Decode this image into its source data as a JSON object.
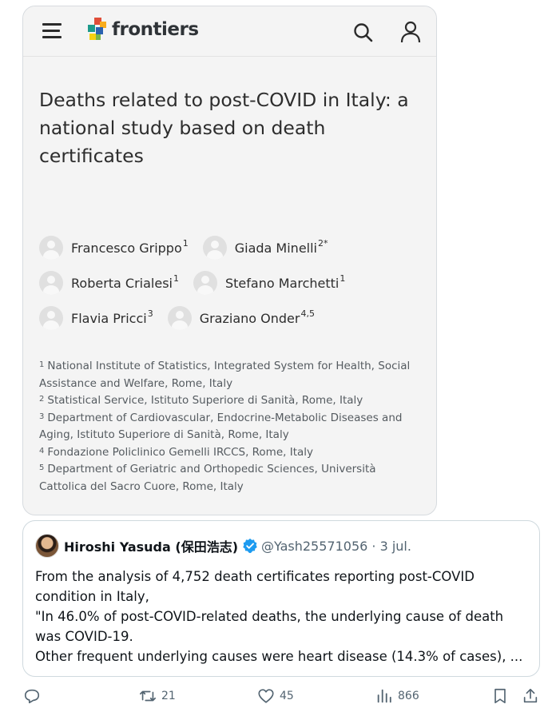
{
  "frontiers_card": {
    "brand": "frontiers",
    "title_lines": [
      "Deaths related to post-COVID in Italy: a",
      "national study based on death",
      "certificates"
    ],
    "authors": [
      {
        "name": "Francesco Grippo",
        "sup": "1"
      },
      {
        "name": "Giada Minelli",
        "sup": "2*"
      },
      {
        "name": "Roberta Crialesi",
        "sup": "1"
      },
      {
        "name": "Stefano Marchetti",
        "sup": "1"
      },
      {
        "name": "Flavia Pricci",
        "sup": "3"
      },
      {
        "name": "Graziano Onder",
        "sup": "4,5"
      }
    ],
    "affiliations": [
      {
        "sup": "1",
        "line1": "National Institute of Statistics, Integrated System for Health, Social",
        "line2": "Assistance and Welfare, Rome, Italy"
      },
      {
        "sup": "2",
        "line1": "Statistical Service, Istituto Superiore di Sanità, Rome, Italy",
        "line2": ""
      },
      {
        "sup": "3",
        "line1": "Department of Cardiovascular, Endocrine-Metabolic Diseases and",
        "line2": "Aging, Istituto Superiore di Sanità, Rome, Italy"
      },
      {
        "sup": "4",
        "line1": "Fondazione Policlinico Gemelli IRCCS, Rome, Italy",
        "line2": ""
      },
      {
        "sup": "5",
        "line1": "Department of Geriatric and Orthopedic Sciences, Università",
        "line2": "Cattolica del Sacro Cuore, Rome, Italy"
      }
    ]
  },
  "tweet": {
    "display_name": "Hiroshi Yasuda (保田浩志)",
    "handle_date": "@Yash25571056 · 3 jul.",
    "lines": [
      "From the analysis of 4,752 death certificates reporting post-COVID",
      "condition in Italy,",
      "\"In 46.0% of post-COVID-related deaths, the underlying cause of death",
      "was COVID-19.",
      "Other frequent underlying causes were heart disease (14.3% of cases), ..."
    ]
  },
  "actions": {
    "retweets": "21",
    "likes": "45",
    "views": "866"
  },
  "colors": {
    "accent": "#1d9bf0",
    "muted": "#536471",
    "card_bg": "#f4f4f4"
  }
}
